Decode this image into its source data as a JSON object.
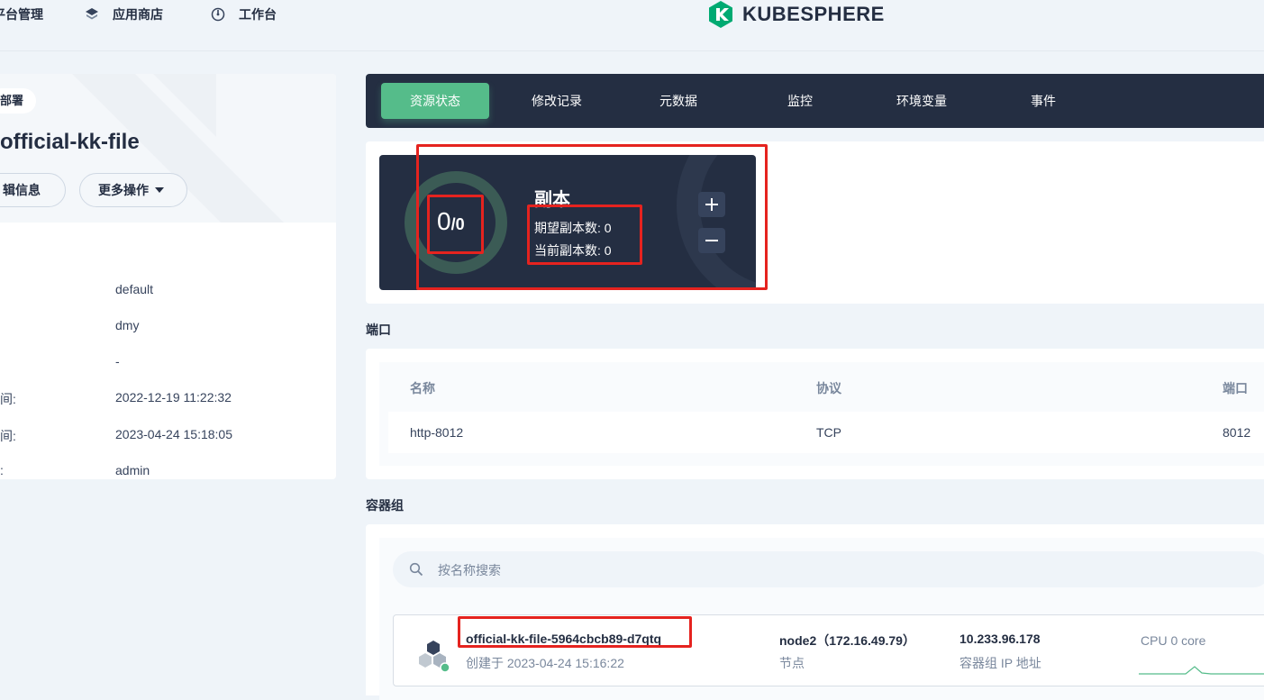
{
  "nav": {
    "items": [
      {
        "label": "平台管理",
        "icon": "platform-icon"
      },
      {
        "label": "应用商店",
        "icon": "app-store-icon"
      },
      {
        "label": "工作台",
        "icon": "workbench-icon"
      }
    ],
    "logo_text": "KUBESPHERE"
  },
  "detail": {
    "badge": "部署",
    "name": "official-kk-file",
    "edit_label": "辑信息",
    "more_label": "更多操作",
    "info": [
      {
        "key": "",
        "value": "default"
      },
      {
        "key": "",
        "value": "dmy"
      },
      {
        "key": "",
        "value": "-"
      },
      {
        "key": "间:",
        "value": "2022-12-19 11:22:32"
      },
      {
        "key": "间:",
        "value": "2023-04-24 15:18:05"
      },
      {
        "key": ":",
        "value": "admin"
      }
    ]
  },
  "tabs": [
    "资源状态",
    "修改记录",
    "元数据",
    "监控",
    "环境变量",
    "事件"
  ],
  "replica": {
    "current": "0",
    "desired": "0",
    "title": "副本",
    "desired_label": "期望副本数: 0",
    "current_label": "当前副本数: 0"
  },
  "ports": {
    "title": "端口",
    "headers": [
      "名称",
      "协议",
      "端口"
    ],
    "rows": [
      [
        "http-8012",
        "TCP",
        "8012"
      ]
    ]
  },
  "pods": {
    "title": "容器组",
    "search_placeholder": "按名称搜索",
    "items": [
      {
        "name": "official-kk-file-5964cbcb89-d7qtq",
        "created": "创建于 2023-04-24 15:16:22",
        "node": "node2（172.16.49.79）",
        "node_label": "节点",
        "ip": "10.233.96.178",
        "ip_label": "容器组 IP 地址",
        "cpu": "CPU 0 core"
      }
    ]
  },
  "colors": {
    "accent": "#55bc8a",
    "dark": "#242e42",
    "highlight": "#e5231f"
  }
}
